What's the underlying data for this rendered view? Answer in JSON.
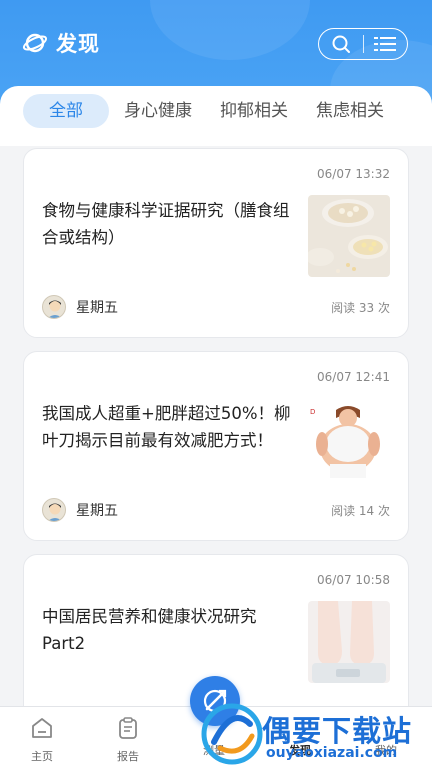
{
  "header": {
    "title": "发现",
    "logo_icon": "planet-icon",
    "search_icon": "search-icon",
    "filter_icon": "list-filter-icon",
    "bg_color": "#3f9af2"
  },
  "tabs": [
    {
      "label": "全部",
      "active": true
    },
    {
      "label": "身心健康",
      "active": false
    },
    {
      "label": "抑郁相关",
      "active": false
    },
    {
      "label": "焦虑相关",
      "active": false
    }
  ],
  "articles": [
    {
      "time": "06/07 13:32",
      "title": "食物与健康科学证据研究（膳食组合或结构）",
      "author": "星期五",
      "reads": "阅读 33 次",
      "thumb": "pills-spoons-image"
    },
    {
      "time": "06/07 12:41",
      "title": "我国成人超重+肥胖超过50%！柳叶刀揭示目前最有效减肥方式！",
      "author": "星期五",
      "reads": "阅读 14 次",
      "thumb": "overweight-person-image"
    },
    {
      "time": "06/07 10:58",
      "title": "中国居民营养和健康状况研究Part2",
      "author": "",
      "reads": "",
      "thumb": "feet-on-scale-image"
    }
  ],
  "bottom_nav": [
    {
      "label": "主页",
      "icon": "home-icon"
    },
    {
      "label": "报告",
      "icon": "clipboard-icon"
    },
    {
      "label": "测量",
      "icon": "measure-icon"
    },
    {
      "label": "发现",
      "icon": "discover-icon",
      "active": true
    },
    {
      "label": "我的",
      "icon": "profile-icon"
    }
  ],
  "watermark": {
    "text": "偶要下载站",
    "url": "ouyaoxiazai.com"
  },
  "colors": {
    "accent": "#2b86e8",
    "tab_active_bg": "#dcebfb",
    "page_bg": "#f3f4f6"
  }
}
